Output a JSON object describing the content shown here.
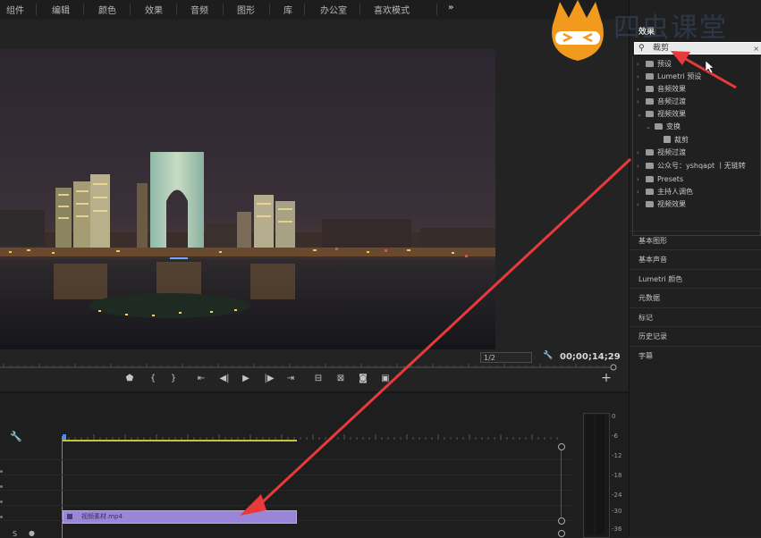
{
  "workspaces": [
    "组件",
    "编辑",
    "颜色",
    "效果",
    "音频",
    "图形",
    "库",
    "办公室",
    "喜欢模式"
  ],
  "workspaces_overflow": "»",
  "monitor": {
    "resolution": "1/2",
    "timecode": "00;00;14;29",
    "transport_buttons": [
      "marker",
      "in",
      "out",
      "go-to-in",
      "step-back",
      "play",
      "step-forward",
      "go-to-out",
      "lift",
      "extract",
      "export-frame",
      "compare"
    ],
    "add_button": "+"
  },
  "timeline": {
    "clip_label": "视频素材.mp4",
    "track_labels": [
      "S"
    ]
  },
  "meter": {
    "db_labels": [
      "0",
      "-6",
      "-12",
      "-18",
      "-24",
      "-30",
      "-36"
    ]
  },
  "effects_panel": {
    "title": "效果",
    "search_value": "裁剪",
    "tree": [
      {
        "label": "预设",
        "level": 0,
        "expanded": false,
        "type": "folder"
      },
      {
        "label": "Lumetri 预设",
        "level": 0,
        "expanded": false,
        "type": "folder"
      },
      {
        "label": "音频效果",
        "level": 0,
        "expanded": false,
        "type": "folder"
      },
      {
        "label": "音频过渡",
        "level": 0,
        "expanded": false,
        "type": "folder"
      },
      {
        "label": "视频效果",
        "level": 0,
        "expanded": true,
        "type": "folder"
      },
      {
        "label": "变换",
        "level": 1,
        "expanded": true,
        "type": "folder"
      },
      {
        "label": "裁剪",
        "level": 2,
        "expanded": false,
        "type": "effect"
      },
      {
        "label": "视频过渡",
        "level": 0,
        "expanded": false,
        "type": "folder"
      },
      {
        "label": "公众号：yshqapt 丨无链转",
        "level": 0,
        "expanded": false,
        "type": "folder"
      },
      {
        "label": "Presets",
        "level": 0,
        "expanded": false,
        "type": "folder"
      },
      {
        "label": "主持人调色",
        "level": 0,
        "expanded": false,
        "type": "folder"
      },
      {
        "label": "视频效果",
        "level": 0,
        "expanded": false,
        "type": "folder"
      }
    ],
    "sections": [
      "基本图形",
      "基本声音",
      "Lumetri 颜色",
      "元数据",
      "标记",
      "历史记录",
      "字幕"
    ]
  },
  "watermark": {
    "text": "四虫课堂"
  },
  "colors": {
    "annotation_arrow": "#e8393b",
    "clip": "#9a86d6",
    "logo_orange": "#f29a1e"
  }
}
